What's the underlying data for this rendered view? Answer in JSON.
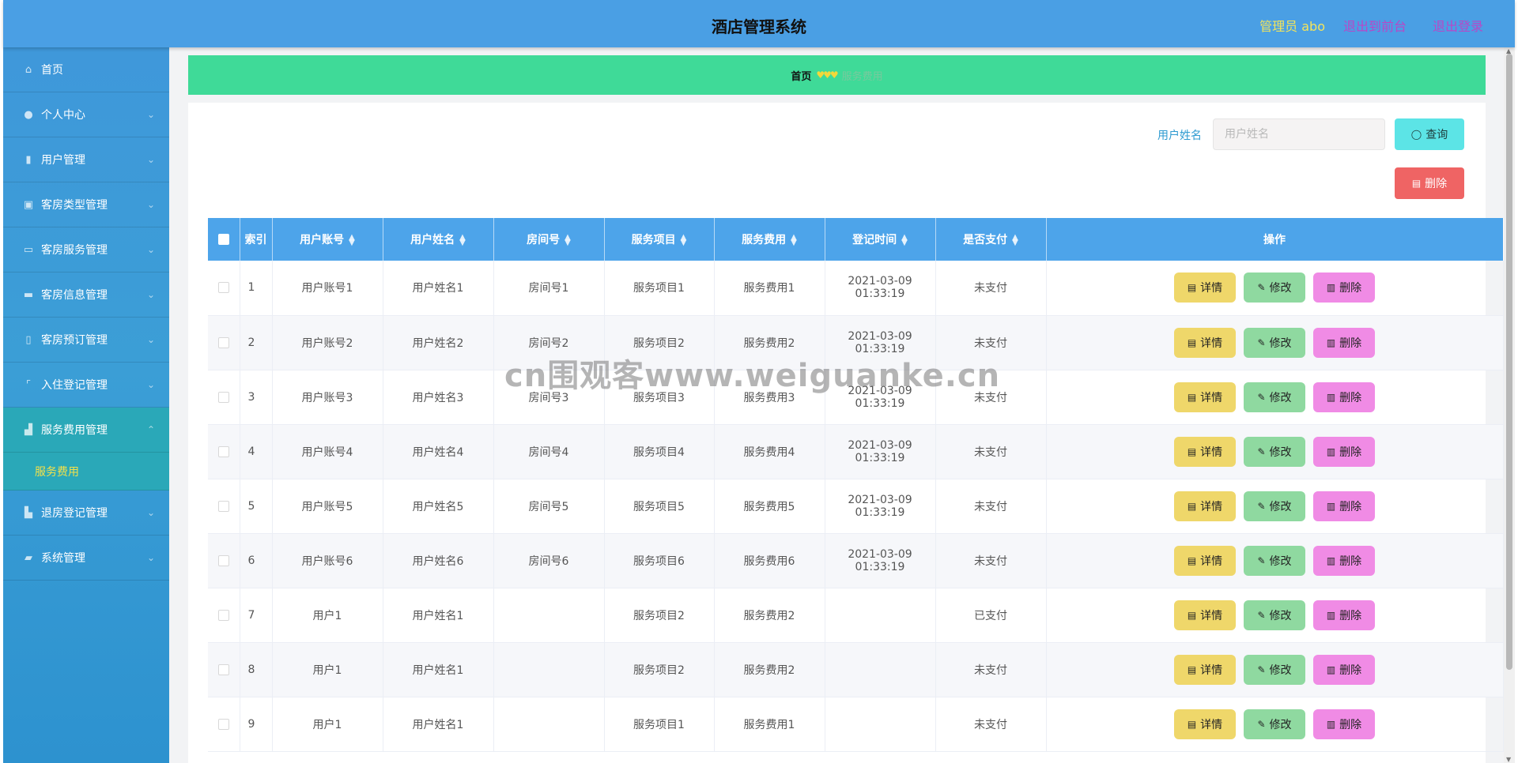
{
  "header": {
    "title": "酒店管理系统",
    "admin": "管理员 abo",
    "front": "退出到前台",
    "logout": "退出登录"
  },
  "sidebar": {
    "items": [
      {
        "label": "首页",
        "icon": "home-icon"
      },
      {
        "label": "个人中心",
        "icon": "user-icon"
      },
      {
        "label": "用户管理",
        "icon": "chart-icon"
      },
      {
        "label": "客房类型管理",
        "icon": "building-icon"
      },
      {
        "label": "客房服务管理",
        "icon": "chat-icon"
      },
      {
        "label": "客房信息管理",
        "icon": "printer-icon"
      },
      {
        "label": "客房预订管理",
        "icon": "phone-icon"
      },
      {
        "label": "入住登记管理",
        "icon": "frame-icon"
      },
      {
        "label": "服务费用管理",
        "icon": "cart-icon"
      },
      {
        "label": "退房登记管理",
        "icon": "building-icon"
      },
      {
        "label": "系统管理",
        "icon": "ticket-icon"
      }
    ],
    "submenu": "服务费用"
  },
  "breadcrumb": {
    "home": "首页",
    "current": "服务费用"
  },
  "search": {
    "label": "用户姓名",
    "placeholder": "用户姓名",
    "query_button": "查询",
    "delete_button": "删除"
  },
  "table": {
    "headers": [
      "索引",
      "用户账号",
      "用户姓名",
      "房间号",
      "服务项目",
      "服务费用",
      "登记时间",
      "是否支付",
      "操作"
    ],
    "ops": {
      "detail": "详情",
      "edit": "修改",
      "delete": "删除"
    },
    "rows": [
      [
        "1",
        "用户账号1",
        "用户姓名1",
        "房间号1",
        "服务项目1",
        "服务费用1",
        "2021-03-09 01:33:19",
        "未支付"
      ],
      [
        "2",
        "用户账号2",
        "用户姓名2",
        "房间号2",
        "服务项目2",
        "服务费用2",
        "2021-03-09 01:33:19",
        "未支付"
      ],
      [
        "3",
        "用户账号3",
        "用户姓名3",
        "房间号3",
        "服务项目3",
        "服务费用3",
        "2021-03-09 01:33:19",
        "未支付"
      ],
      [
        "4",
        "用户账号4",
        "用户姓名4",
        "房间号4",
        "服务项目4",
        "服务费用4",
        "2021-03-09 01:33:19",
        "未支付"
      ],
      [
        "5",
        "用户账号5",
        "用户姓名5",
        "房间号5",
        "服务项目5",
        "服务费用5",
        "2021-03-09 01:33:19",
        "未支付"
      ],
      [
        "6",
        "用户账号6",
        "用户姓名6",
        "房间号6",
        "服务项目6",
        "服务费用6",
        "2021-03-09 01:33:19",
        "未支付"
      ],
      [
        "7",
        "用户1",
        "用户姓名1",
        "",
        "服务项目2",
        "服务费用2",
        "",
        "已支付"
      ],
      [
        "8",
        "用户1",
        "用户姓名1",
        "",
        "服务项目2",
        "服务费用2",
        "",
        "未支付"
      ],
      [
        "9",
        "用户1",
        "用户姓名1",
        "",
        "服务项目1",
        "服务费用1",
        "",
        "未支付"
      ]
    ]
  },
  "watermark": "cn围观客www.weiguanke.cn",
  "colors": {
    "header": "#4a9fe4",
    "breadcrumb": "#3fda98",
    "table_header": "#4da4ea",
    "query": "#5ce4e6",
    "danger": "#ef6464"
  }
}
